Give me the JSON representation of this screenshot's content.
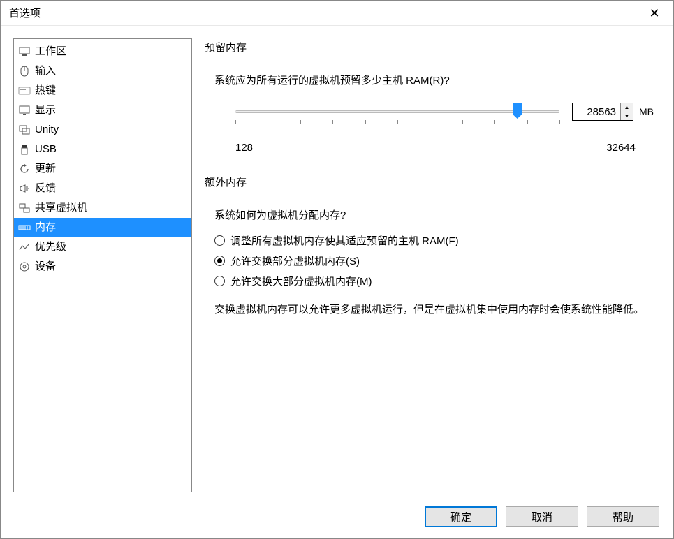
{
  "window": {
    "title": "首选项"
  },
  "sidebar": {
    "items": [
      {
        "label": "工作区"
      },
      {
        "label": "输入"
      },
      {
        "label": "热键"
      },
      {
        "label": "显示"
      },
      {
        "label": "Unity"
      },
      {
        "label": "USB"
      },
      {
        "label": "更新"
      },
      {
        "label": "反馈"
      },
      {
        "label": "共享虚拟机"
      },
      {
        "label": "内存"
      },
      {
        "label": "优先级"
      },
      {
        "label": "设备"
      }
    ],
    "selected_index": 9
  },
  "reserved_memory": {
    "legend": "预留内存",
    "question": "系统应为所有运行的虚拟机预留多少主机 RAM(R)?",
    "slider_min_label": "128",
    "slider_max_label": "32644",
    "value": "28563",
    "unit": "MB"
  },
  "extra_memory": {
    "legend": "额外内存",
    "question": "系统如何为虚拟机分配内存?",
    "options": [
      {
        "label": "调整所有虚拟机内存使其适应预留的主机 RAM(F)",
        "checked": false
      },
      {
        "label": "允许交换部分虚拟机内存(S)",
        "checked": true
      },
      {
        "label": "允许交换大部分虚拟机内存(M)",
        "checked": false
      }
    ],
    "note": "交换虚拟机内存可以允许更多虚拟机运行，但是在虚拟机集中使用内存时会使系统性能降低。"
  },
  "footer": {
    "ok": "确定",
    "cancel": "取消",
    "help": "帮助"
  }
}
